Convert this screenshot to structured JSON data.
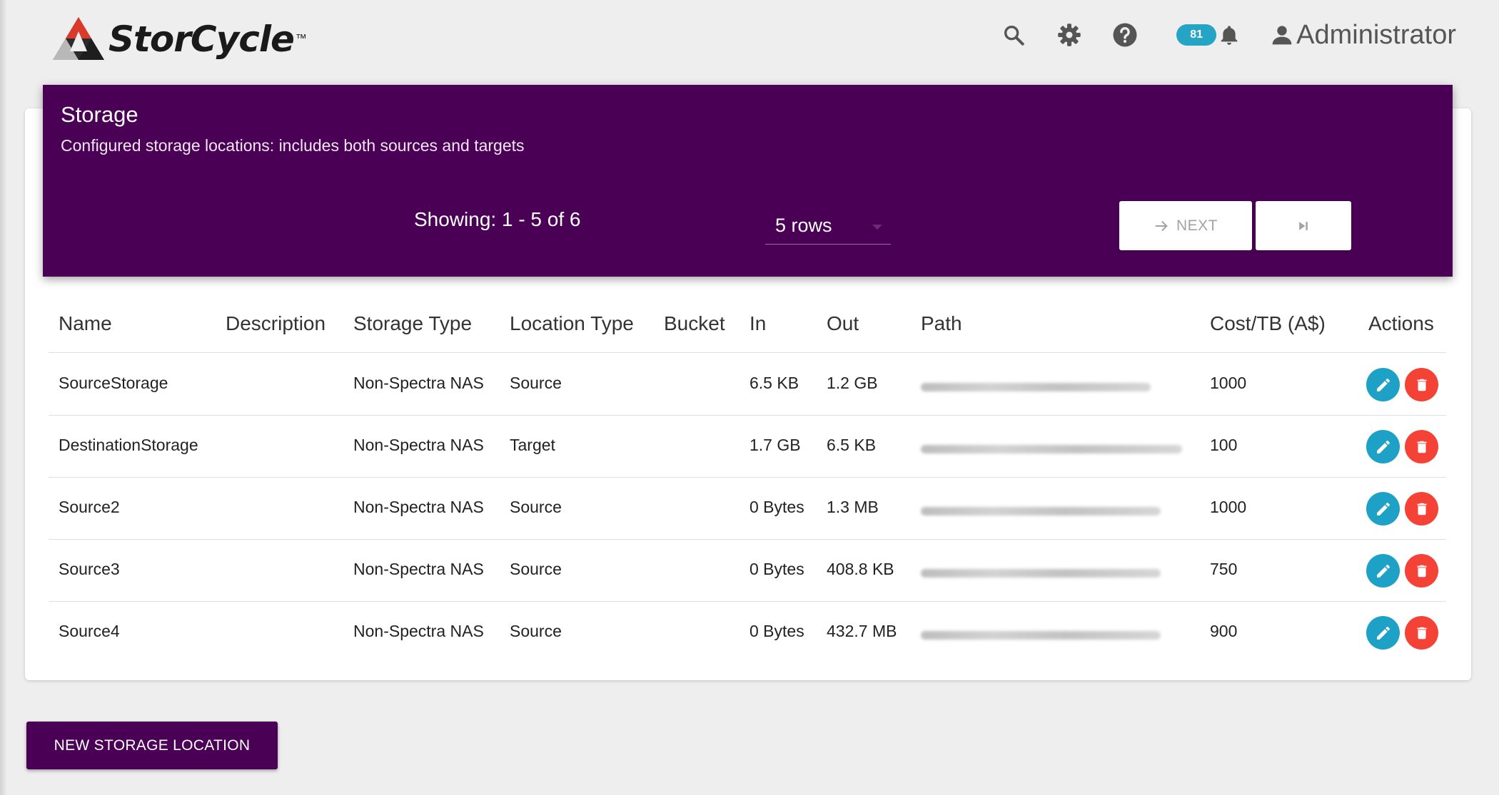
{
  "app": {
    "logo_text": "StorCycle",
    "logo_tm": "™"
  },
  "header": {
    "notifications_count": "81",
    "user_name": "Administrator"
  },
  "banner": {
    "title": "Storage",
    "subtitle": "Configured storage locations: includes both sources and targets",
    "showing": "Showing: 1 - 5 of 6",
    "rows_per_page": "5 rows",
    "next_label": "NEXT",
    "color": "#4a0055"
  },
  "table": {
    "columns": {
      "name": "Name",
      "description": "Description",
      "storage_type": "Storage Type",
      "location_type": "Location Type",
      "bucket": "Bucket",
      "in": "In",
      "out": "Out",
      "path": "Path",
      "cost": "Cost/TB (A$)",
      "actions": "Actions"
    },
    "rows": [
      {
        "name": "SourceStorage",
        "description": "",
        "storage_type": "Non-Spectra NAS",
        "location_type": "Source",
        "bucket": "",
        "in": "6.5 KB",
        "out": "1.2 GB",
        "cost": "1000"
      },
      {
        "name": "DestinationStorage",
        "description": "",
        "storage_type": "Non-Spectra NAS",
        "location_type": "Target",
        "bucket": "",
        "in": "1.7 GB",
        "out": "6.5 KB",
        "cost": "100"
      },
      {
        "name": "Source2",
        "description": "",
        "storage_type": "Non-Spectra NAS",
        "location_type": "Source",
        "bucket": "",
        "in": "0 Bytes",
        "out": "1.3 MB",
        "cost": "1000"
      },
      {
        "name": "Source3",
        "description": "",
        "storage_type": "Non-Spectra NAS",
        "location_type": "Source",
        "bucket": "",
        "in": "0 Bytes",
        "out": "408.8 KB",
        "cost": "750"
      },
      {
        "name": "Source4",
        "description": "",
        "storage_type": "Non-Spectra NAS",
        "location_type": "Source",
        "bucket": "",
        "in": "0 Bytes",
        "out": "432.7 MB",
        "cost": "900"
      }
    ]
  },
  "footer": {
    "new_button_label": "NEW STORAGE LOCATION"
  },
  "icons": {
    "edit": "pencil-icon",
    "delete": "trash-icon",
    "search": "search-icon",
    "settings": "gear-icon",
    "help": "help-icon",
    "notifications": "bell-icon",
    "user": "person-icon"
  },
  "colors": {
    "edit_button": "#1da1c6",
    "delete_button": "#f44336",
    "badge": "#26a4c6"
  }
}
